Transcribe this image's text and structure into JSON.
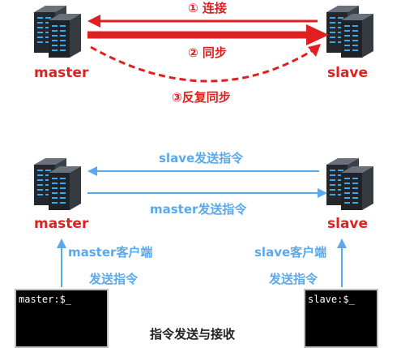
{
  "top": {
    "master_label": "master",
    "slave_label": "slave",
    "step1": "① 连接",
    "step2": "② 同步",
    "step3": "③反复同步"
  },
  "bottom": {
    "master_label": "master",
    "slave_label": "slave",
    "slave_to_master": "slave发送指令",
    "master_to_slave": "master发送指令",
    "master_client_line1": "master客户端",
    "master_client_line2": "发送指令",
    "slave_client_line1": "slave客户端",
    "slave_client_line2": "发送指令",
    "master_prompt": "master:$_",
    "slave_prompt": "slave:$_",
    "caption": "指令发送与接收"
  },
  "colors": {
    "red": "#e02020",
    "blue": "#5aa9ee",
    "server_dark": "#1f2227",
    "server_light": "#3a4048",
    "server_led": "#3ba7e6",
    "terminal_bg": "#000000"
  }
}
